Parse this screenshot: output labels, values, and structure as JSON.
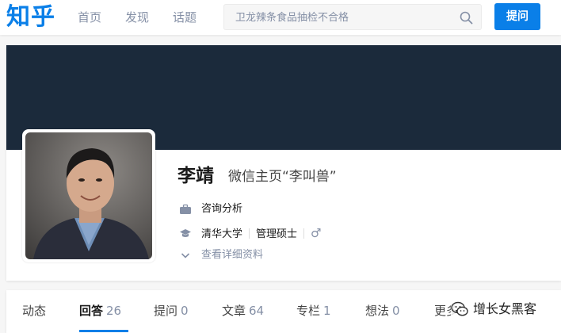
{
  "header": {
    "logo": "知乎",
    "nav": [
      "首页",
      "发现",
      "话题"
    ],
    "search_placeholder": "卫龙辣条食品抽检不合格",
    "ask_label": "提问",
    "brand_color": "#0a7fe8"
  },
  "profile": {
    "name": "李靖",
    "headline": "微信主页“李叫兽”",
    "industry": "咨询分析",
    "school": "清华大学",
    "major": "管理硕士",
    "gender_symbol": "♂",
    "more_info": "查看详细资料",
    "cover_color": "#1b2a3b"
  },
  "tabs": [
    {
      "label": "动态",
      "count": ""
    },
    {
      "label": "回答",
      "count": "26",
      "active": true
    },
    {
      "label": "提问",
      "count": "0"
    },
    {
      "label": "文章",
      "count": "64"
    },
    {
      "label": "专栏",
      "count": "1"
    },
    {
      "label": "想法",
      "count": "0"
    },
    {
      "label": "更多",
      "count": ""
    }
  ],
  "watermark": "增长女黑客"
}
